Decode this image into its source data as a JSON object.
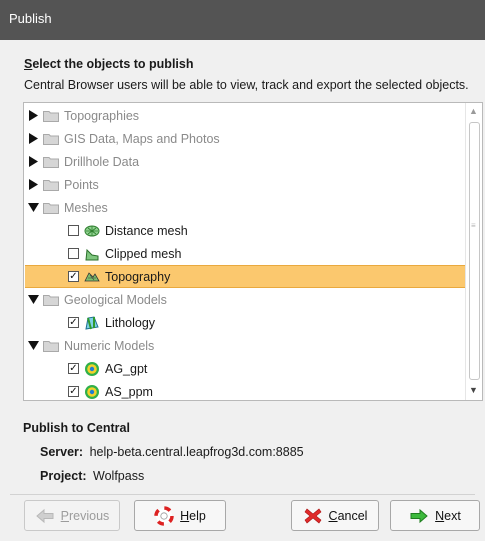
{
  "window": {
    "title": "Publish"
  },
  "header": {
    "title": "Select the objects to publish",
    "title_mnemonic": "S",
    "title_rest": "elect the objects to publish",
    "description": "Central Browser users will be able to view, track and export the selected objects."
  },
  "tree": {
    "items": [
      {
        "label": "Topographies",
        "type": "folder",
        "expanded": false,
        "dim": true
      },
      {
        "label": "GIS Data, Maps and Photos",
        "type": "folder",
        "expanded": false,
        "dim": true
      },
      {
        "label": "Drillhole Data",
        "type": "folder",
        "expanded": false,
        "dim": true
      },
      {
        "label": "Points",
        "type": "folder",
        "expanded": false,
        "dim": true
      },
      {
        "label": "Meshes",
        "type": "folder",
        "expanded": true,
        "dim": true
      },
      {
        "label": "Distance mesh",
        "type": "object",
        "checked": false,
        "icon": "distance-mesh-icon"
      },
      {
        "label": "Clipped mesh",
        "type": "object",
        "checked": false,
        "icon": "clipped-mesh-icon"
      },
      {
        "label": "Topography",
        "type": "object",
        "checked": true,
        "selected": true,
        "icon": "topography-icon"
      },
      {
        "label": "Geological Models",
        "type": "folder",
        "expanded": true,
        "dim": true
      },
      {
        "label": "Lithology",
        "type": "object",
        "checked": true,
        "icon": "lithology-icon"
      },
      {
        "label": "Numeric Models",
        "type": "folder",
        "expanded": true,
        "dim": true
      },
      {
        "label": "AG_gpt",
        "type": "object",
        "checked": true,
        "icon": "numeric-model-icon"
      },
      {
        "label": "AS_ppm",
        "type": "object",
        "checked": true,
        "icon": "numeric-model-icon"
      }
    ]
  },
  "publish": {
    "title": "Publish to Central",
    "server_label": "Server:",
    "server_value": "help-beta.central.leapfrog3d.com:8885",
    "project_label": "Project:",
    "project_value": "Wolfpass"
  },
  "buttons": {
    "previous": {
      "mnemonic": "P",
      "rest": "revious",
      "enabled": false
    },
    "help": {
      "mnemonic": "H",
      "rest": "elp"
    },
    "cancel": {
      "mnemonic": "C",
      "rest": "ancel"
    },
    "next": {
      "mnemonic": "N",
      "rest": "ext"
    }
  },
  "colors": {
    "titlebar": "#545454",
    "selection": "#fbc86e",
    "folder": "#cfcfcf"
  }
}
